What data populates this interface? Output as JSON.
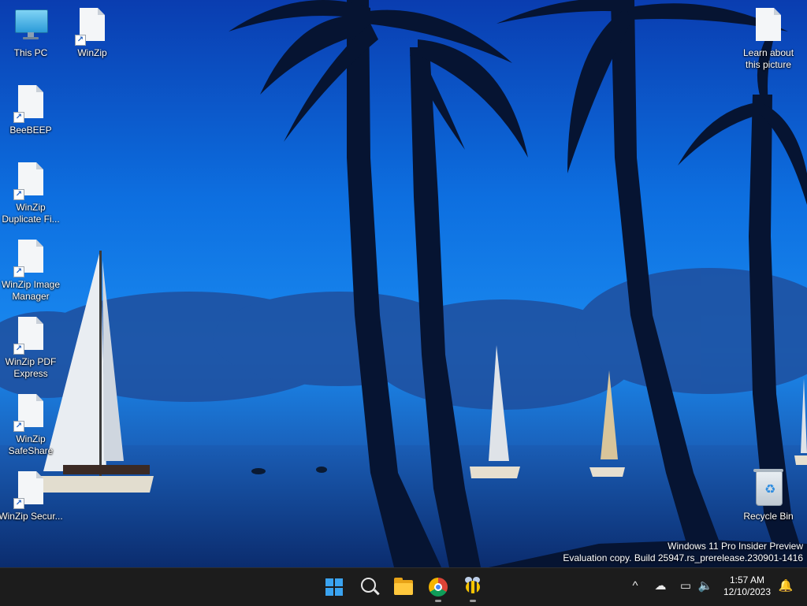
{
  "desktop": {
    "icons": [
      {
        "label": "This PC"
      },
      {
        "label": "WinZip"
      },
      {
        "label": "BeeBEEP"
      },
      {
        "label": "WinZip Duplicate Fi..."
      },
      {
        "label": "WinZip Image Manager"
      },
      {
        "label": "WinZip PDF Express"
      },
      {
        "label": "WinZip SafeShare"
      },
      {
        "label": "WinZip Secur..."
      },
      {
        "label": "Learn about this picture"
      },
      {
        "label": "Recycle Bin"
      }
    ]
  },
  "watermark": {
    "line1": "Windows 11 Pro Insider Preview",
    "line2": "Evaluation copy. Build 25947.rs_prerelease.230901-1416"
  },
  "taskbar": {
    "pinned": [
      "start-icon",
      "search-icon",
      "file-explorer-icon",
      "chrome-icon",
      "beebeep-icon"
    ],
    "tray": {
      "chevron": "^",
      "time": "1:57 AM",
      "date": "12/10/2023"
    }
  },
  "colors": {
    "taskbar": "#1c1c1c",
    "accent": "#3aa3f0"
  }
}
